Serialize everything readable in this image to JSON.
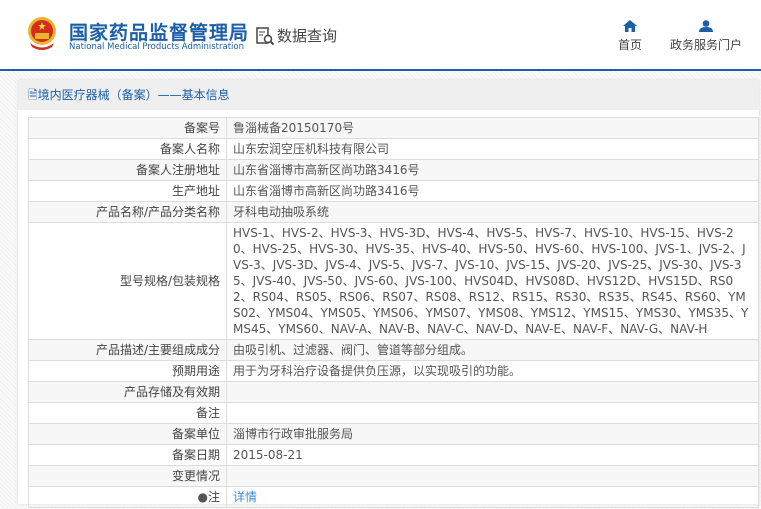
{
  "header": {
    "logo_cn": "国家药品监督管理局",
    "logo_en": "National Medical Products Administration",
    "query": "数据查询",
    "nav": [
      {
        "label": "首页",
        "icon": "home-icon"
      },
      {
        "label": "政务服务门户",
        "icon": "user-icon"
      }
    ]
  },
  "panel": {
    "title": "境内医疗器械（备案）——基本信息"
  },
  "rows": [
    {
      "label": "备案号",
      "value": "鲁淄械备20150170号"
    },
    {
      "label": "备案人名称",
      "value": "山东宏润空压机科技有限公司"
    },
    {
      "label": "备案人注册地址",
      "value": "山东省淄博市高新区尚功路3416号"
    },
    {
      "label": "生产地址",
      "value": "山东省淄博市高新区尚功路3416号"
    },
    {
      "label": "产品名称/产品分类名称",
      "value": "牙科电动抽吸系统"
    },
    {
      "label": "型号规格/包装规格",
      "value": "HVS-1、HVS-2、HVS-3、HVS-3D、HVS-4、HVS-5、HVS-7、HVS-10、HVS-15、HVS-20、HVS-25、HVS-30、HVS-35、HVS-40、HVS-50、HVS-60、HVS-100、JVS-1、JVS-2、JVS-3、JVS-3D、JVS-4、JVS-5、JVS-7、JVS-10、JVS-15、JVS-20、JVS-25、JVS-30、JVS-35、JVS-40、JVS-50、JVS-60、JVS-100、HVS04D、HVS08D、HVS12D、HVS15D、RS02、RS04、RS05、RS06、RS07、RS08、RS12、RS15、RS30、RS35、RS45、RS60、YMS02、YMS04、YMS05、YMS06、YMS07、YMS08、YMS12、YMS15、YMS30、YMS35、YMS45、YMS60、NAV-A、NAV-B、NAV-C、NAV-D、NAV-E、NAV-F、NAV-G、NAV-H"
    },
    {
      "label": "产品描述/主要组成成分",
      "value": "由吸引机、过滤器、阀门、管道等部分组成。"
    },
    {
      "label": "预期用途",
      "value": "用于为牙科治疗设备提供负压源，以实现吸引的功能。"
    },
    {
      "label": "产品存储及有效期",
      "value": ""
    },
    {
      "label": "备注",
      "value": ""
    },
    {
      "label": "备案单位",
      "value": "淄博市行政审批服务局"
    },
    {
      "label": "备案日期",
      "value": "2015-08-21"
    },
    {
      "label": "变更情况",
      "value": ""
    },
    {
      "label": "注",
      "value": "详情"
    }
  ]
}
